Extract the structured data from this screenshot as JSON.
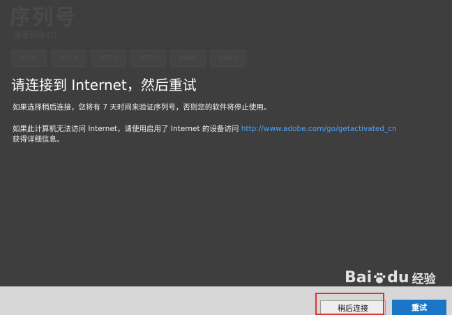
{
  "background": {
    "title": "序列号",
    "subtitle": "需要帮助 (?)",
    "serial_boxes": [
      "1100",
      "1618",
      "0774",
      "9720",
      "6005",
      "8443"
    ]
  },
  "dialog": {
    "heading": "请连接到 Internet，然后重试",
    "paragraph1": "如果选择稍后连接，您将有 7 天时间来验证序列号，否则您的软件将停止使用。",
    "paragraph2_prefix": "如果此计算机无法访问 Internet，请使用启用了 Internet 的设备访问 ",
    "paragraph2_link": "http://www.adobe.com/go/getactivated_cn",
    "paragraph2_suffix": "获得详细信息。"
  },
  "buttons": {
    "later_label": "稍后连接",
    "retry_label": "重试"
  },
  "watermark": {
    "text1": "Bai",
    "text2": "du",
    "text3": "经验"
  },
  "colors": {
    "background": "#3e3e3e",
    "link": "#4aa3ff",
    "retry_button": "#1b76c8",
    "highlight": "#e0322c"
  }
}
